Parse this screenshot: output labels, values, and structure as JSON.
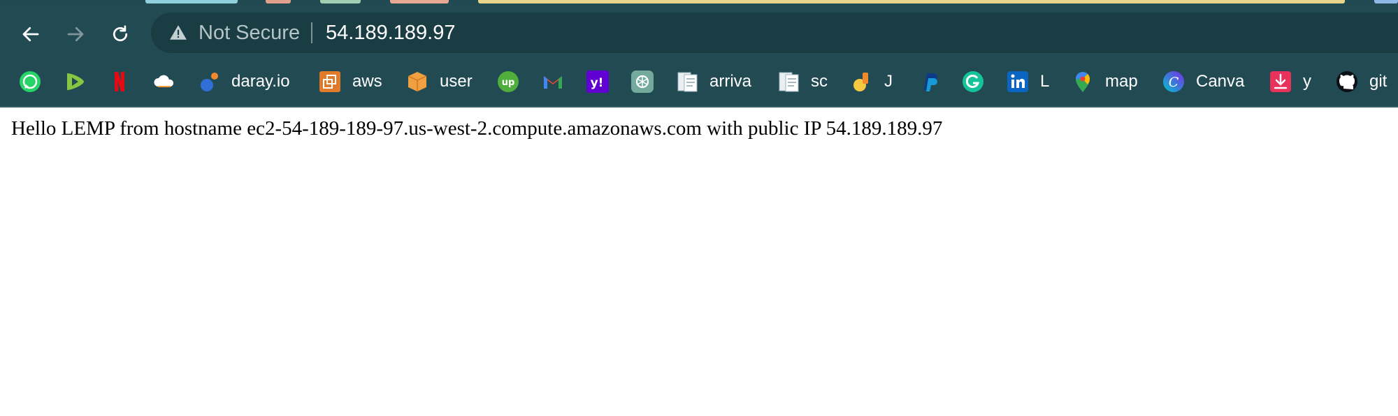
{
  "browser": {
    "security_label": "Not Secure",
    "url": "54.189.189.97"
  },
  "icons": {
    "back": "arrow-left-icon",
    "forward": "arrow-right-icon",
    "reload": "reload-icon",
    "warning": "warning-triangle-icon"
  },
  "bookmarks": [
    {
      "icon": "whatsapp-icon",
      "label": ""
    },
    {
      "icon": "rumble-icon",
      "label": ""
    },
    {
      "icon": "netflix-icon",
      "label": ""
    },
    {
      "icon": "cloud-icon",
      "label": ""
    },
    {
      "icon": "daray-icon",
      "label": "daray.io"
    },
    {
      "icon": "aws-icon",
      "label": "aws"
    },
    {
      "icon": "box-icon",
      "label": "user"
    },
    {
      "icon": "upwork-icon",
      "label": ""
    },
    {
      "icon": "gmail-icon",
      "label": ""
    },
    {
      "icon": "yahoo-icon",
      "label": ""
    },
    {
      "icon": "chatgpt-icon",
      "label": ""
    },
    {
      "icon": "document-icon",
      "label": "arriva"
    },
    {
      "icon": "document-icon",
      "label": "sc"
    },
    {
      "icon": "jira-icon",
      "label": "J"
    },
    {
      "icon": "paypal-icon",
      "label": ""
    },
    {
      "icon": "grammarly-icon",
      "label": ""
    },
    {
      "icon": "linkedin-icon",
      "label": "L"
    },
    {
      "icon": "maps-icon",
      "label": "map"
    },
    {
      "icon": "canva-icon",
      "label": "Canva"
    },
    {
      "icon": "download-icon",
      "label": "y"
    },
    {
      "icon": "github-icon",
      "label": "git"
    }
  ],
  "page": {
    "text": "Hello LEMP from hostname ec2-54-189-189-97.us-west-2.compute.amazonaws.com with public IP 54.189.189.97"
  },
  "colors": {
    "toolbar": "#224a52",
    "omnibox": "#1a3c43",
    "page_background": "#ffffff"
  }
}
